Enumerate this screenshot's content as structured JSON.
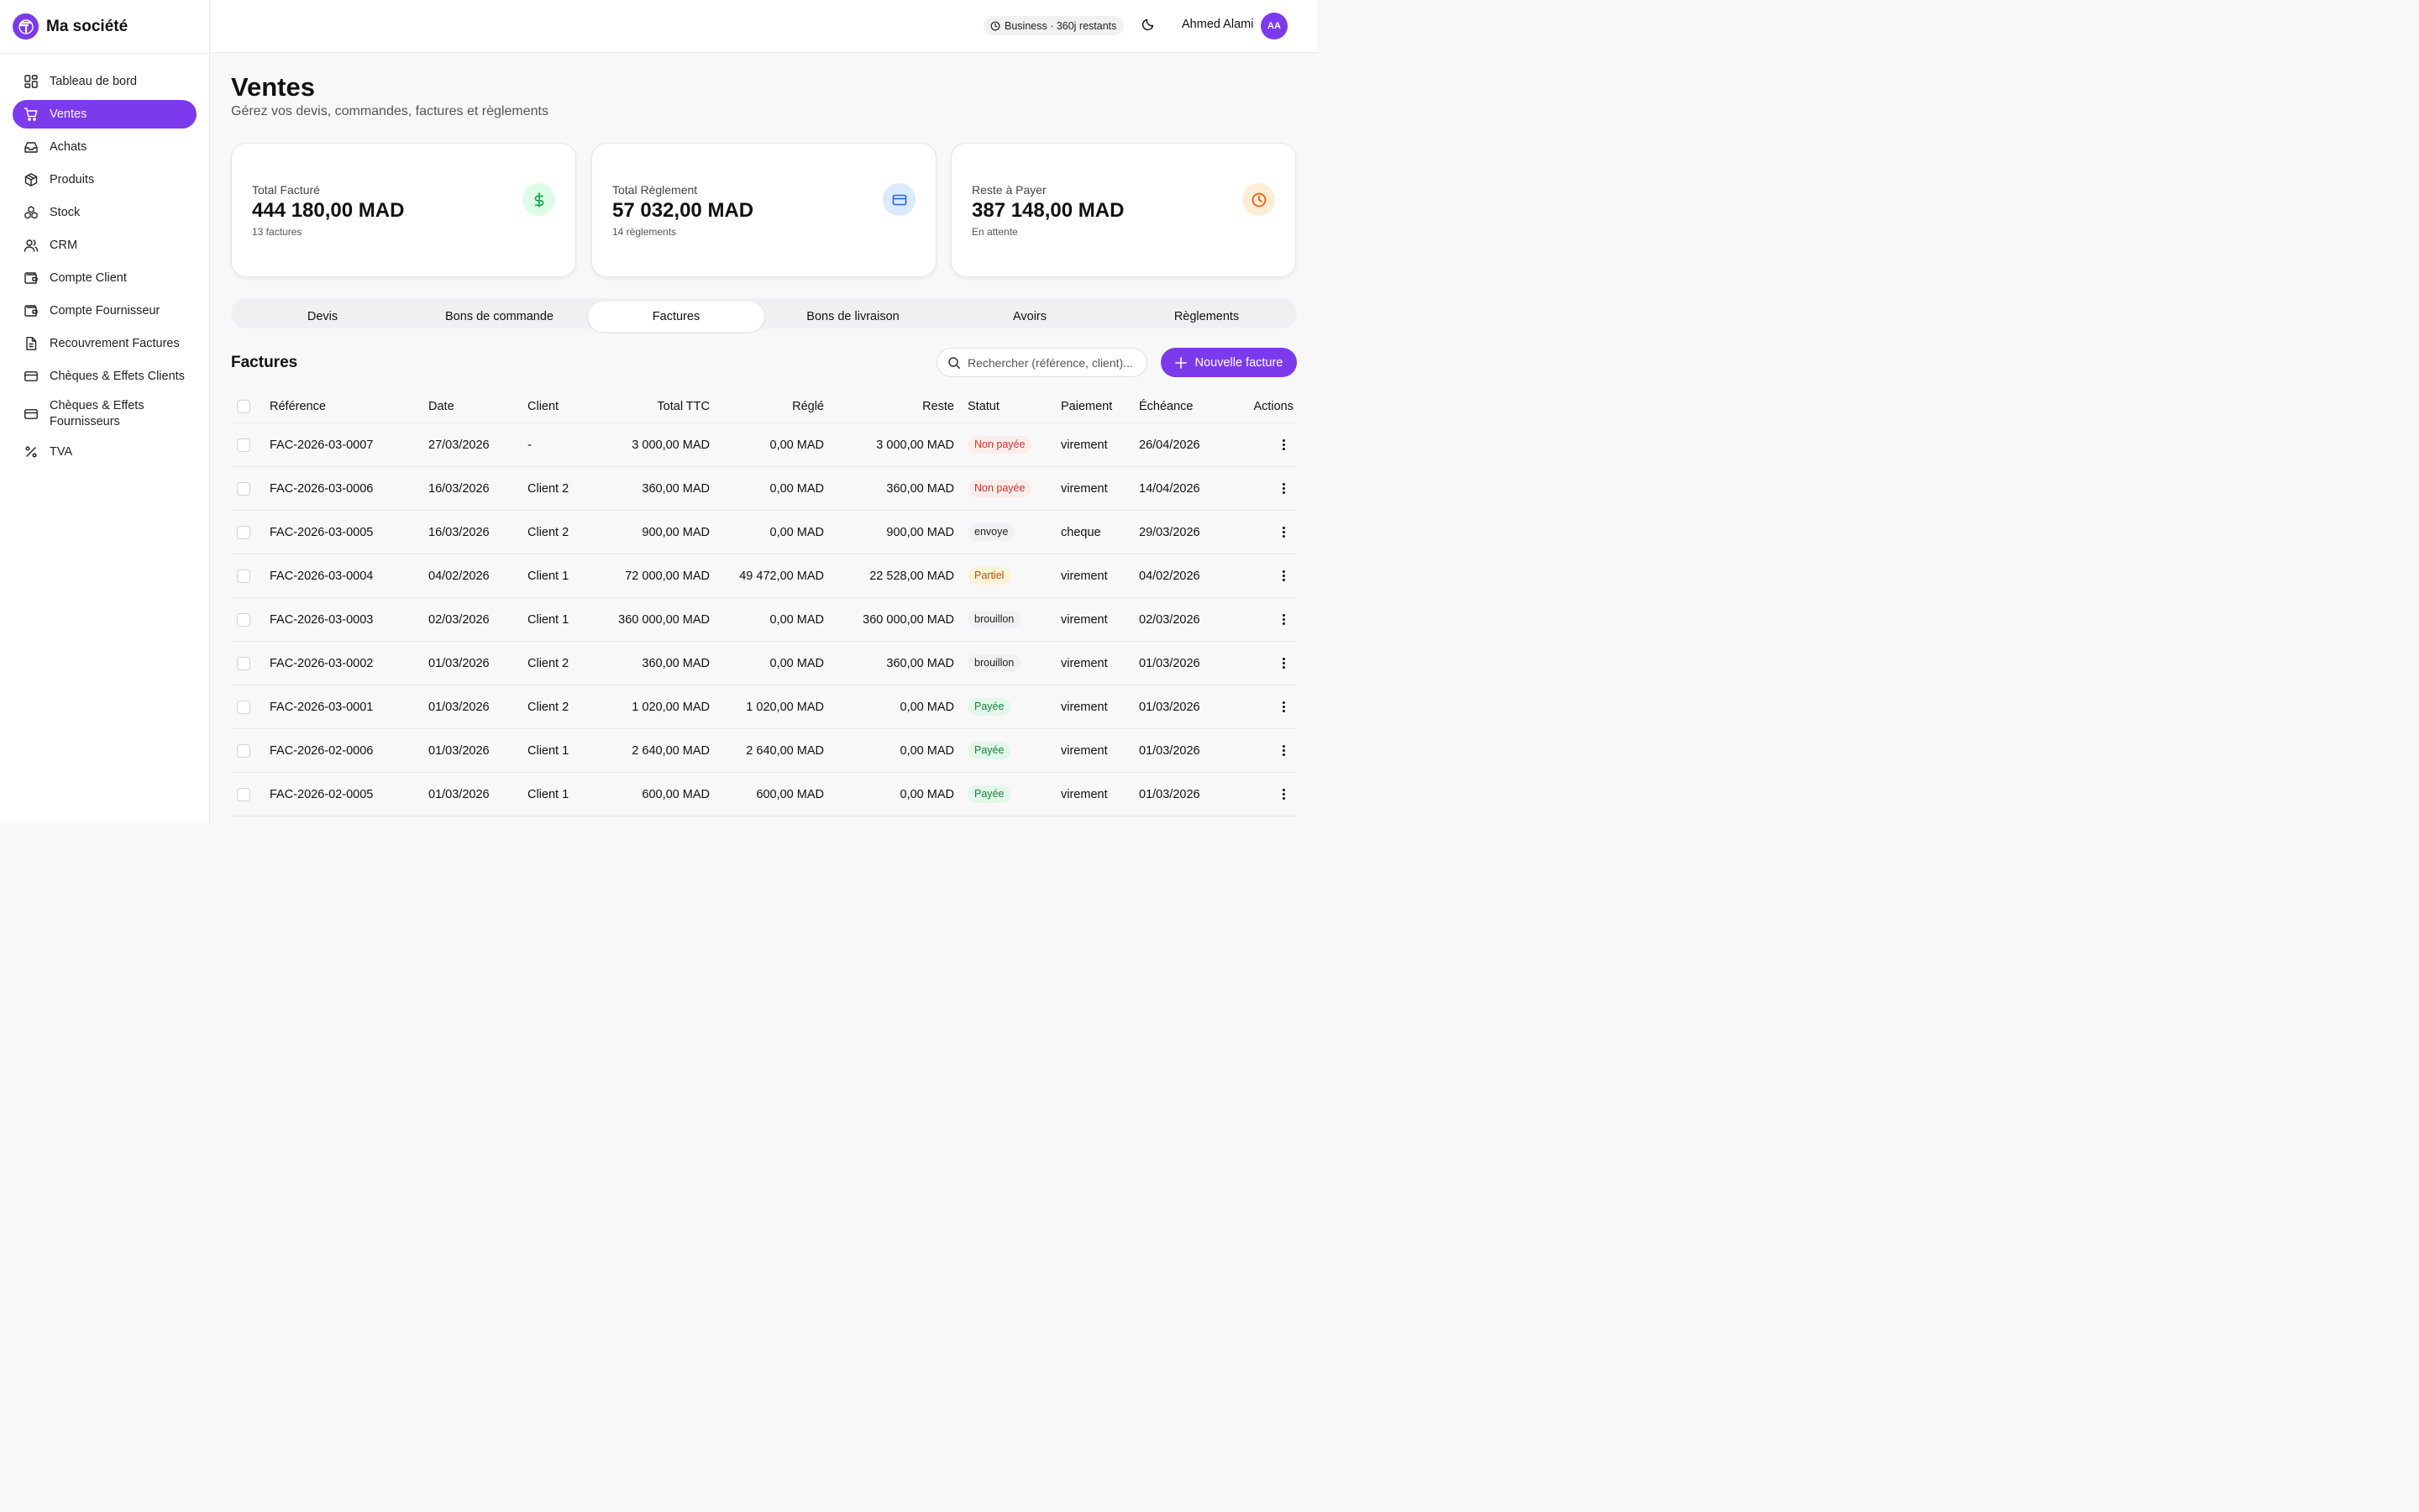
{
  "brand": {
    "name": "Ma société"
  },
  "sidebar": {
    "items": [
      {
        "label": "Tableau de bord",
        "icon": "dashboard-icon"
      },
      {
        "label": "Ventes",
        "icon": "cart-icon",
        "active": true
      },
      {
        "label": "Achats",
        "icon": "inbox-icon"
      },
      {
        "label": "Produits",
        "icon": "package-icon"
      },
      {
        "label": "Stock",
        "icon": "boxes-icon"
      },
      {
        "label": "CRM",
        "icon": "users-icon"
      },
      {
        "label": "Compte Client",
        "icon": "wallet-icon"
      },
      {
        "label": "Compte Fournisseur",
        "icon": "wallet-icon"
      },
      {
        "label": "Recouvrement Factures",
        "icon": "file-text-icon"
      },
      {
        "label": "Chèques & Effets Clients",
        "icon": "credit-card-icon"
      },
      {
        "label": "Chèques & Effets Fournisseurs",
        "icon": "credit-card-icon"
      },
      {
        "label": "TVA",
        "icon": "percent-icon"
      }
    ]
  },
  "topbar": {
    "plan": "Business · 360j restants",
    "user_name": "Ahmed Alami",
    "avatar_initials": "AA"
  },
  "page": {
    "title": "Ventes",
    "subtitle": "Gérez vos devis, commandes, factures et règlements"
  },
  "cards": [
    {
      "label": "Total Facturé",
      "value": "444 180,00 MAD",
      "sub": "13 factures",
      "icon": "dollar-icon",
      "color": "#16a34a",
      "bg": "#dcfce7"
    },
    {
      "label": "Total Règlement",
      "value": "57 032,00 MAD",
      "sub": "14 règlements",
      "icon": "credit-card-icon",
      "color": "#2563eb",
      "bg": "#dbeafe"
    },
    {
      "label": "Reste à Payer",
      "value": "387 148,00 MAD",
      "sub": "En attente",
      "icon": "clock-icon",
      "color": "#ea580c",
      "bg": "#ffedd5"
    }
  ],
  "tabs": [
    {
      "label": "Devis"
    },
    {
      "label": "Bons de commande"
    },
    {
      "label": "Factures",
      "active": true
    },
    {
      "label": "Bons de livraison"
    },
    {
      "label": "Avoirs"
    },
    {
      "label": "Règlements"
    }
  ],
  "section": {
    "title": "Factures",
    "search_placeholder": "Rechercher (référence, client)...",
    "new_button": "Nouvelle facture"
  },
  "table": {
    "headers": {
      "ref": "Référence",
      "date": "Date",
      "client": "Client",
      "ttc": "Total TTC",
      "regle": "Réglé",
      "reste": "Reste",
      "statut": "Statut",
      "paiement": "Paiement",
      "echeance": "Échéance",
      "actions": "Actions"
    },
    "rows": [
      {
        "ref": "FAC-2026-03-0007",
        "date": "27/03/2026",
        "client": "-",
        "ttc": "3 000,00 MAD",
        "regle": "0,00 MAD",
        "reste": "3 000,00 MAD",
        "statut": "Non payée",
        "statut_kind": "unpaid",
        "paiement": "virement",
        "echeance": "26/04/2026"
      },
      {
        "ref": "FAC-2026-03-0006",
        "date": "16/03/2026",
        "client": "Client 2",
        "ttc": "360,00 MAD",
        "regle": "0,00 MAD",
        "reste": "360,00 MAD",
        "statut": "Non payée",
        "statut_kind": "unpaid",
        "paiement": "virement",
        "echeance": "14/04/2026"
      },
      {
        "ref": "FAC-2026-03-0005",
        "date": "16/03/2026",
        "client": "Client 2",
        "ttc": "900,00 MAD",
        "regle": "0,00 MAD",
        "reste": "900,00 MAD",
        "statut": "envoye",
        "statut_kind": "sent",
        "paiement": "cheque",
        "echeance": "29/03/2026"
      },
      {
        "ref": "FAC-2026-03-0004",
        "date": "04/02/2026",
        "client": "Client 1",
        "ttc": "72 000,00 MAD",
        "regle": "49 472,00 MAD",
        "reste": "22 528,00 MAD",
        "statut": "Partiel",
        "statut_kind": "partial",
        "paiement": "virement",
        "echeance": "04/02/2026"
      },
      {
        "ref": "FAC-2026-03-0003",
        "date": "02/03/2026",
        "client": "Client 1",
        "ttc": "360 000,00 MAD",
        "regle": "0,00 MAD",
        "reste": "360 000,00 MAD",
        "statut": "brouillon",
        "statut_kind": "draft",
        "paiement": "virement",
        "echeance": "02/03/2026"
      },
      {
        "ref": "FAC-2026-03-0002",
        "date": "01/03/2026",
        "client": "Client 2",
        "ttc": "360,00 MAD",
        "regle": "0,00 MAD",
        "reste": "360,00 MAD",
        "statut": "brouillon",
        "statut_kind": "draft",
        "paiement": "virement",
        "echeance": "01/03/2026"
      },
      {
        "ref": "FAC-2026-03-0001",
        "date": "01/03/2026",
        "client": "Client 2",
        "ttc": "1 020,00 MAD",
        "regle": "1 020,00 MAD",
        "reste": "0,00 MAD",
        "statut": "Payée",
        "statut_kind": "paid",
        "paiement": "virement",
        "echeance": "01/03/2026"
      },
      {
        "ref": "FAC-2026-02-0006",
        "date": "01/03/2026",
        "client": "Client 1",
        "ttc": "2 640,00 MAD",
        "regle": "2 640,00 MAD",
        "reste": "0,00 MAD",
        "statut": "Payée",
        "statut_kind": "paid",
        "paiement": "virement",
        "echeance": "01/03/2026"
      },
      {
        "ref": "FAC-2026-02-0005",
        "date": "01/03/2026",
        "client": "Client 1",
        "ttc": "600,00 MAD",
        "regle": "600,00 MAD",
        "reste": "0,00 MAD",
        "statut": "Payée",
        "statut_kind": "paid",
        "paiement": "virement",
        "echeance": "01/03/2026"
      }
    ]
  }
}
